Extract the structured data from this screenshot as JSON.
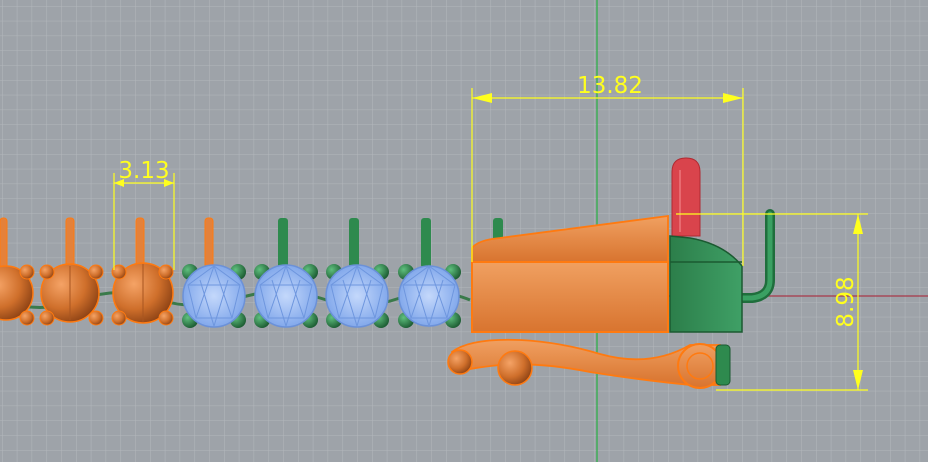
{
  "viewport": {
    "background": "#9ea3a9",
    "grid_color": "#b3b7bc",
    "axis_y_color": "#2fb04a",
    "axis_x_color": "#a7394a"
  },
  "dimensions": {
    "gem_width": "3.13",
    "clasp_width": "13.82",
    "clasp_height": "8.98",
    "color": "#ffff1e"
  },
  "materials": {
    "selected_orange": "#e4813a",
    "selected_outline": "#ff7a10",
    "green_metal": "#2e8a4e",
    "blue_stone": "#9bbcf2",
    "red_pin": "#d9444c"
  },
  "objects": {
    "gem_chain": "gem-chain",
    "clasp": "box-clasp",
    "safety_latch": "safety-latch",
    "tongue_pin": "tongue-pin"
  }
}
